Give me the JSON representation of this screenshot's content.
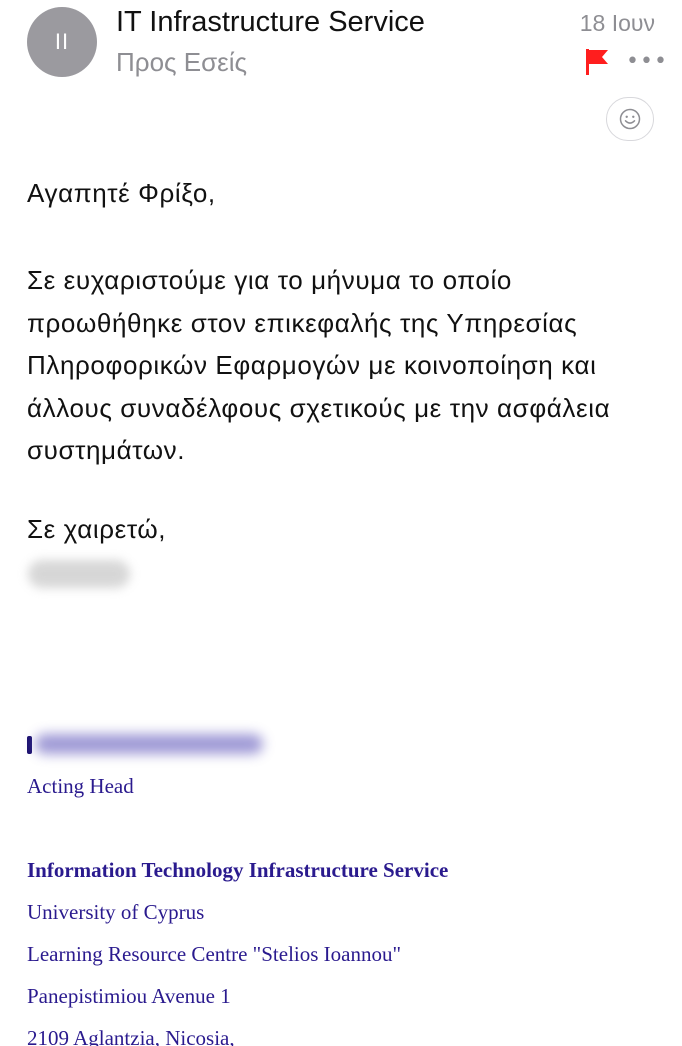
{
  "header": {
    "avatar_initials": "II",
    "sender": "IT Infrastructure Service",
    "recipient": "Προς Εσείς",
    "date": "18 Ιουν",
    "flag_color": "#ff1e1e"
  },
  "actions": {
    "more_icon": "more-icon",
    "emoji_icon": "smiley-icon"
  },
  "message": {
    "greeting": "Αγαπητέ Φρίξο,",
    "paragraph": "Σε ευχαριστούμε για το μήνυμα το οποίο προωθήθηκε στον επικεφαλής της Υπηρεσίας Πληροφορικών Εφαρμογών με κοινοποίηση και άλλους συναδέλφους σχετικούς με την ασφάλεια συστημάτων.",
    "closing": "Σε χαιρετώ,"
  },
  "signature": {
    "role": "Acting Head",
    "organization": "Information Technology Infrastructure Service",
    "university": "University of Cyprus",
    "building": "Learning Resource Centre \"Stelios Ioannou\"",
    "address": "Panepistimiou Avenue 1",
    "city": "2109 Aglantzia, Nicosia,",
    "color": "#2a1a8e"
  }
}
